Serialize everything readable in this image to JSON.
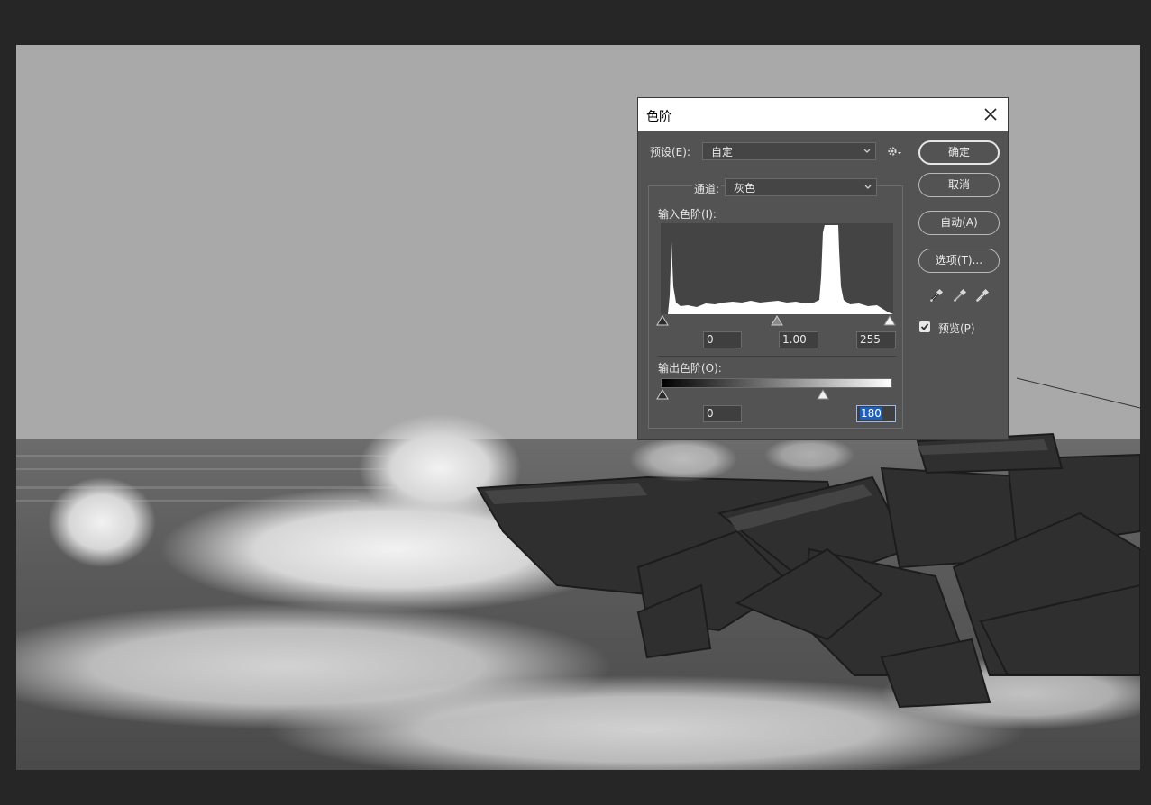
{
  "dialog": {
    "title": "色阶",
    "preset_label": "预设(E):",
    "preset_value": "自定",
    "channel_label": "通道:",
    "channel_value": "灰色",
    "input_levels_label": "输入色阶(I):",
    "input_black": "0",
    "input_gamma": "1.00",
    "input_white": "255",
    "output_levels_label": "输出色阶(O):",
    "output_black": "0",
    "output_white": "180",
    "buttons": {
      "ok": "确定",
      "cancel": "取消",
      "auto": "自动(A)",
      "options": "选项(T)..."
    },
    "preview_label": "预览(P)",
    "preview_checked": true
  },
  "icons": {
    "close": "close-icon",
    "gear": "gear-icon",
    "dropper_black": "eyedropper-black-icon",
    "dropper_gray": "eyedropper-gray-icon",
    "dropper_white": "eyedropper-white-icon"
  },
  "colors": {
    "dialog_bg": "#535353",
    "canvas_bg": "#262626",
    "selection": "#1e5fba"
  }
}
